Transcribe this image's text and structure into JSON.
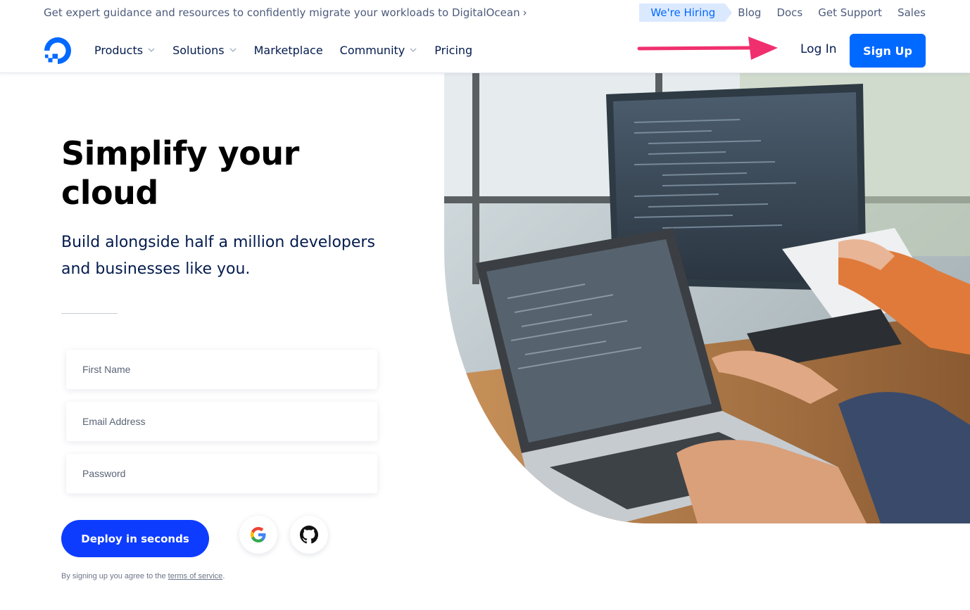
{
  "topbar": {
    "promo_text": "Get expert guidance and resources to confidently migrate your workloads to DigitalOcean",
    "promo_chevron": "›",
    "hiring_label": "We're Hiring",
    "links": [
      "Blog",
      "Docs",
      "Get Support",
      "Sales"
    ]
  },
  "nav": {
    "items": [
      {
        "label": "Products",
        "has_dropdown": true
      },
      {
        "label": "Solutions",
        "has_dropdown": true
      },
      {
        "label": "Marketplace",
        "has_dropdown": false
      },
      {
        "label": "Community",
        "has_dropdown": true
      },
      {
        "label": "Pricing",
        "has_dropdown": false
      }
    ],
    "login_label": "Log In",
    "signup_label": "Sign Up"
  },
  "hero": {
    "title": "Simplify your cloud",
    "subtitle": "Build alongside half a million developers and businesses like you."
  },
  "form": {
    "first_name_placeholder": "First Name",
    "email_placeholder": "Email Address",
    "password_placeholder": "Password",
    "submit_label": "Deploy in seconds",
    "terms_prefix": "By signing up you agree to the",
    "terms_link": "terms of service",
    "terms_suffix": "."
  },
  "icons": {
    "logo": "digitalocean-logo",
    "arrow": "annotation-arrow-icon",
    "google": "google-icon",
    "github": "github-icon"
  },
  "colors": {
    "brand_blue": "#0069ff",
    "deploy_blue": "#0e3cff",
    "navy_text": "#031b4e",
    "arrow_pink": "#f0306e",
    "hiring_bg": "#dbe9ff"
  }
}
